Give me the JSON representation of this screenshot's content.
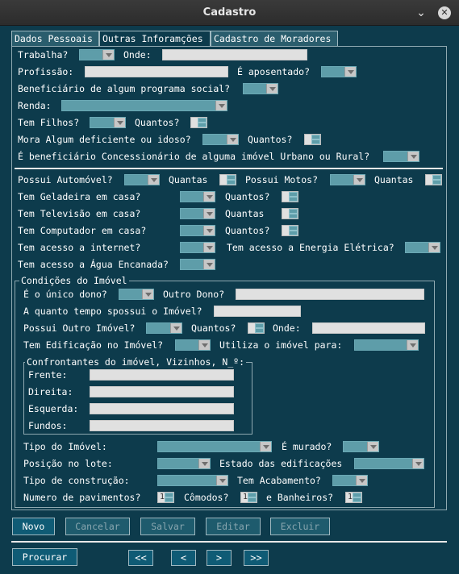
{
  "window": {
    "title": "Cadastro",
    "min": "⌄",
    "close": "✕"
  },
  "tabs": [
    "Dados Pessoais",
    "Outras Inforamções",
    "Cadastro de Moradores"
  ],
  "l": {
    "trabalha": "Trabalha?",
    "onde": "Onde:",
    "profissao": "Profissão:",
    "aposentado": "É aposentado?",
    "beneficiario": "Beneficiário de algum programa social?",
    "renda": "Renda:",
    "filhos": "Tem Filhos?",
    "quantos": "Quantos?",
    "deficiente": "Mora Algum deficiente ou idoso?",
    "concessionario": "É beneficiário Concessionário de alguma imóvel Urbano ou Rural?",
    "automovel": "Possui Automóvel?",
    "quantas": "Quantas",
    "motos": "Possui Motos?",
    "geladeira": "Tem Geladeira em casa?",
    "televisao": "Tem Televisão em casa?",
    "computador": "Tem Computador em casa?",
    "internet": "Tem acesso a internet?",
    "energia": "Tem acesso a Energia Elétrica?",
    "agua": "Tem acesso a Água Encanada?",
    "condicoes": "Condições do Imóvel",
    "unico": "É o único dono?",
    "outro_dono": "Outro Dono?",
    "tempo": "A quanto tempo spossui o Imóvel?",
    "outro_imovel": "Possui Outro Imóvel?",
    "edificacao": "Tem Edificação no Imóvel?",
    "utiliza": "Utiliza o imóvel para:",
    "confrontantes": "Confrontantes do imóvel, Vizinhos, N̲º:",
    "frente": "Frente:",
    "direita": "Direita:",
    "esquerda": "Esquerda:",
    "fundos": "Fundos:",
    "tipo": "Tipo do Imóvel:",
    "murado": "É murado?",
    "posicao": "Posição no lote:",
    "estado": "Estado das edificações",
    "construcao": "Tipo de construção:",
    "acabamento": "Tem Acabamento?",
    "pavimentos": "Numero de pavimentos?",
    "comodos": "Cômodos?",
    "banheiros": "e Banheiros?"
  },
  "spin": {
    "pav": "1",
    "com": "1",
    "ban": "1"
  },
  "buttons": {
    "novo": "Novo",
    "cancelar": "Cancelar",
    "salvar": "Salvar",
    "editar": "Editar",
    "excluir": "Excluir",
    "procurar": "Procurar"
  },
  "nav": {
    "first": "<<",
    "prev": "<",
    "next": ">",
    "last": ">>"
  }
}
